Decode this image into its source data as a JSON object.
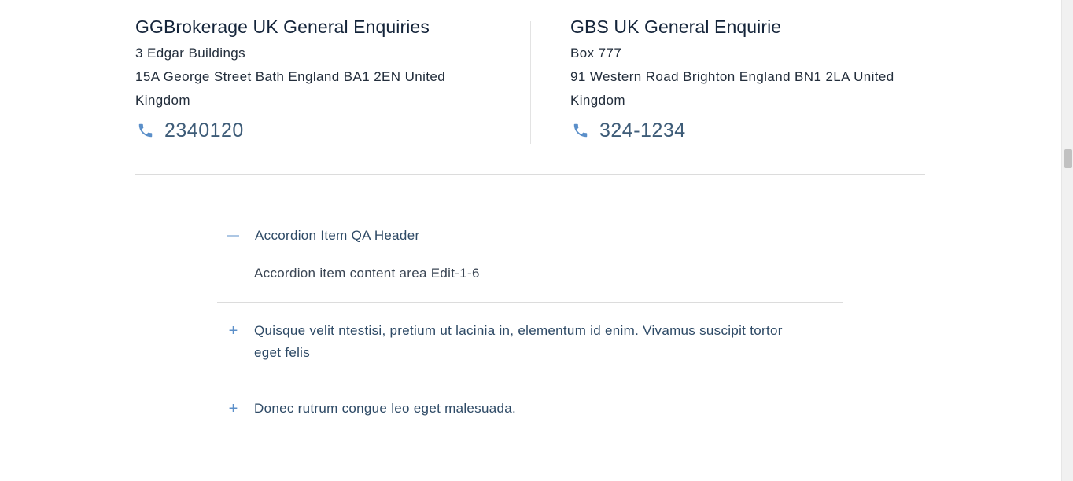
{
  "contacts": [
    {
      "title": "GGBrokerage UK General Enquiries",
      "address_line1": "3 Edgar Buildings",
      "address_line2": "15A George Street Bath England BA1 2EN United",
      "address_line3": "Kingdom",
      "phone": "2340120",
      "icon": "phone-icon"
    },
    {
      "title": "GBS UK General Enquirie",
      "address_line1": "Box 777",
      "address_line2": "91 Western Road Brighton England BN1 2LA United",
      "address_line3": "Kingdom",
      "phone": "324-1234",
      "icon": "phone-icon"
    }
  ],
  "accordion": {
    "items": [
      {
        "toggle": "—",
        "title": "Accordion Item QA Header",
        "expanded": true,
        "content": "Accordion item content area Edit-1-6"
      },
      {
        "toggle": "+",
        "title_line1": "Quisque velit ntestisi, pretium ut lacinia in, elementum id enim. Vivamus suscipit tortor",
        "title_line2": "eget felis",
        "expanded": false
      },
      {
        "toggle": "+",
        "title": "Donec rutrum congue leo eget malesuada.",
        "expanded": false
      }
    ]
  },
  "colors": {
    "accent": "#5b8fc9",
    "heading": "#14243a",
    "link": "#3e5c78",
    "divider": "#dcdcdc"
  }
}
